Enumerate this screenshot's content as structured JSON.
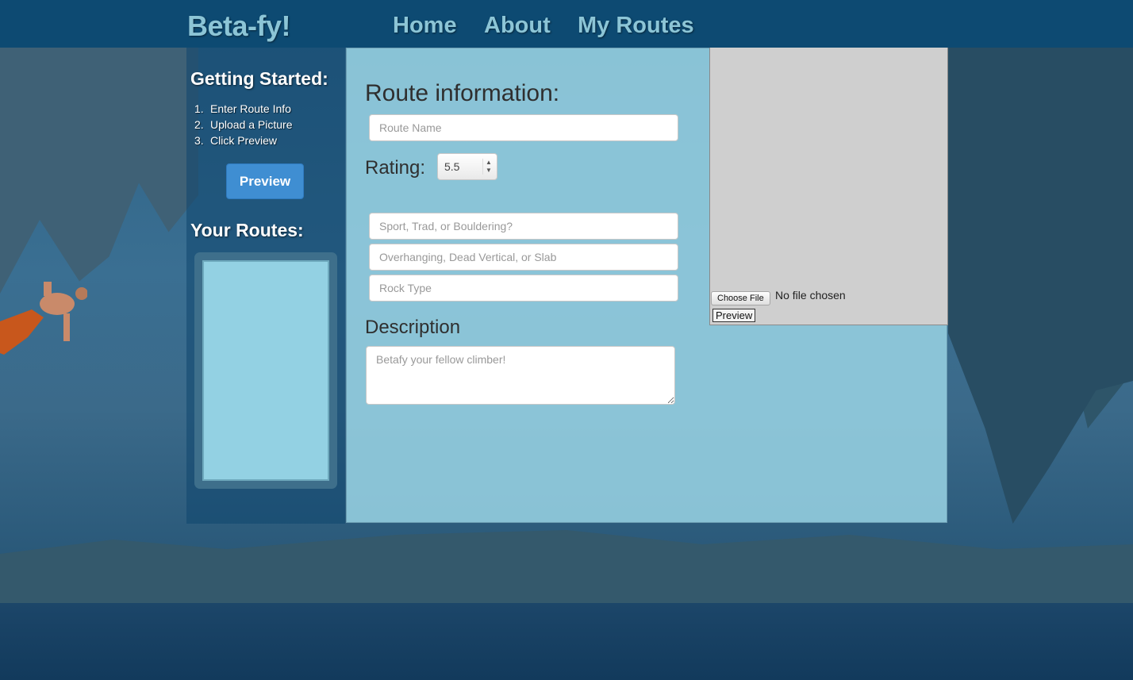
{
  "header": {
    "brand": "Beta-fy!",
    "nav": [
      "Home",
      "About",
      "My Routes"
    ]
  },
  "sidebar": {
    "getting_started_title": "Getting Started:",
    "steps": [
      {
        "num": "1.",
        "text": "Enter Route Info"
      },
      {
        "num": "2.",
        "text": "Upload a Picture"
      },
      {
        "num": "3.",
        "text": "Click Preview"
      }
    ],
    "preview_label": "Preview",
    "your_routes_title": "Your Routes:"
  },
  "form": {
    "title": "Route information:",
    "route_name_placeholder": "Route Name",
    "rating_label": "Rating:",
    "rating_value": "5.5",
    "style_placeholder": "Sport, Trad, or Bouldering?",
    "angle_placeholder": "Overhanging, Dead Vertical, or Slab",
    "rock_placeholder": "Rock Type",
    "description_title": "Description",
    "description_placeholder": "Betafy your fellow climber!"
  },
  "image_panel": {
    "choose_file_label": "Choose File",
    "file_status": "No file chosen",
    "preview_label": "Preview"
  },
  "colors": {
    "topbar": "#0d4a72",
    "brand_text": "#8cc5d6",
    "panel": "#96d0e1",
    "accent_button": "#3f8ed2"
  }
}
